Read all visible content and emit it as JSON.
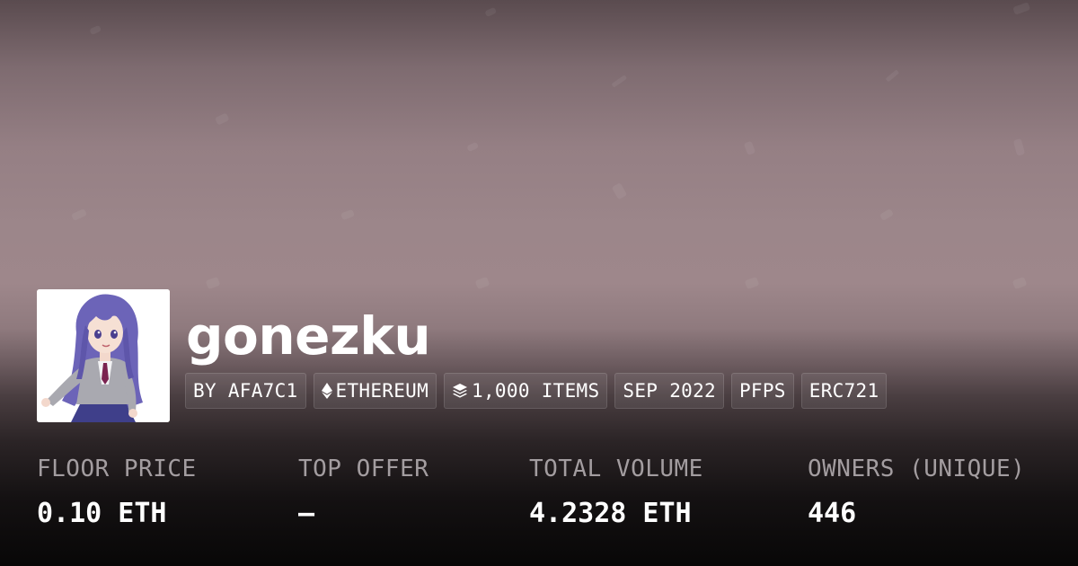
{
  "collection": {
    "name": "gonezku"
  },
  "tags": {
    "creator": "BY AFA7C1",
    "chain": "ETHEREUM",
    "chain_icon": "ethereum-icon",
    "items": "1,000 ITEMS",
    "items_icon": "layers-icon",
    "created": "SEP 2022",
    "category": "PFPS",
    "standard": "ERC721"
  },
  "stats": {
    "floor_price": {
      "label": "FLOOR PRICE",
      "value": "0.10 ETH"
    },
    "top_offer": {
      "label": "TOP OFFER",
      "value": "—"
    },
    "total_volume": {
      "label": "TOTAL VOLUME",
      "value": "4.2328 ETH"
    },
    "owners": {
      "label": "OWNERS (UNIQUE)",
      "value": "446"
    }
  },
  "colors": {
    "banner_mauve": "#9c868a",
    "background_dark": "#080707",
    "stat_label": "#a39da0",
    "text": "#ffffff"
  }
}
